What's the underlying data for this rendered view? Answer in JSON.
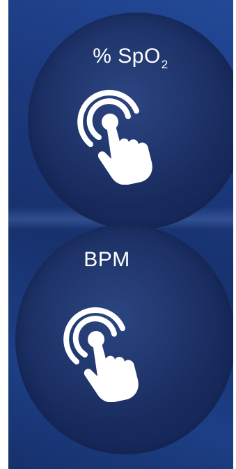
{
  "panels": [
    {
      "label_main": "% SpO",
      "label_subscript": "2",
      "icon": "tap-gesture-icon"
    },
    {
      "label_main": "BPM",
      "label_subscript": "",
      "icon": "tap-gesture-icon"
    }
  ],
  "colors": {
    "background_top": "#234a97",
    "background_bottom": "#16306b",
    "circle": "#1c2f66",
    "foreground": "#ffffff"
  }
}
